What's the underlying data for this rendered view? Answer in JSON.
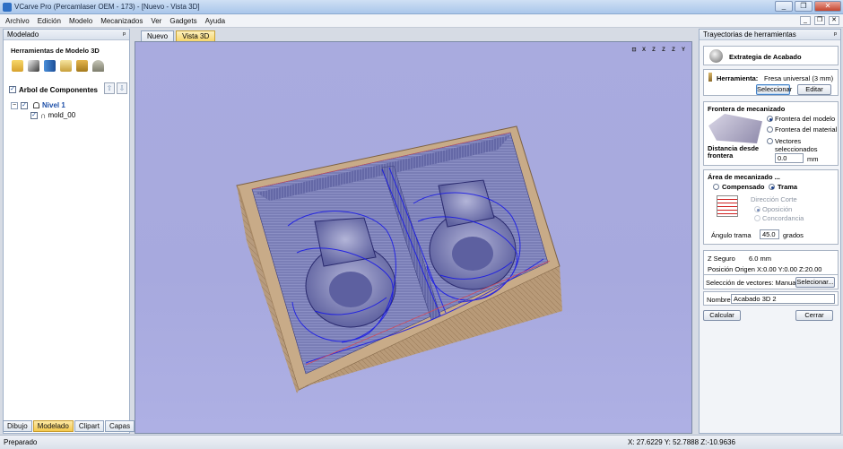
{
  "window": {
    "title": "VCarve Pro (Percamlaser OEM - 173) - [Nuevo - Vista 3D]",
    "min_label": "_",
    "restore_label": "❐",
    "close_label": "✕"
  },
  "menu": [
    "Archivo",
    "Edición",
    "Modelo",
    "Mecanizados",
    "Ver",
    "Gadgets",
    "Ayuda"
  ],
  "menu_icons": [
    "_",
    "❐",
    "✕"
  ],
  "left_panel": {
    "header": "Modelado",
    "pin": "ᵖ",
    "section_title": "Herramientas de Modelo 3D",
    "tools": [
      "open-folder-icon",
      "wrench-icon",
      "arrow-right-icon",
      "edit-pencil-icon",
      "lock-icon",
      "pile-icon"
    ],
    "component_title": "Arbol de Componentes",
    "tree": [
      {
        "label": "Nivel 1",
        "expander": "−"
      },
      {
        "label": "mold_00"
      }
    ],
    "tabs": [
      "Dibujo",
      "Modelado",
      "Clipart",
      "Capas"
    ],
    "active_tab": "Modelado"
  },
  "doc_tabs": [
    "Nuevo",
    "Vista 3D"
  ],
  "active_doc_tab": "Vista 3D",
  "view_icons": [
    "⊡",
    "X",
    "Z",
    "Z",
    "Z",
    "Y"
  ],
  "right_panel": {
    "header": "Trayectorias de herramientas",
    "pin": "ᵖ",
    "strategy": "Extrategia de Acabado",
    "tool_label": "Herramienta:",
    "tool_name": "Fresa universal (3 mm)",
    "select_btn": "Seleccionar",
    "edit_btn": "Editar",
    "boundary_title": "Frontera de mecanizado",
    "boundary_options": [
      "Frontera del modelo",
      "Frontera del material",
      "Vectores seleccionados"
    ],
    "boundary_selected": 0,
    "distance_label": "Distancia desde frontera",
    "distance_value": "0.0",
    "distance_unit": "mm",
    "area_title": "Área de mecanizado ...",
    "area_options": [
      "Compensado",
      "Trama"
    ],
    "area_selected": 1,
    "cut_direction_label": "Dirección Corte",
    "cut_direction_options": [
      "Oposición",
      "Concordancia"
    ],
    "angle_label": "Ángulo trama",
    "angle_value": "45.0",
    "angle_unit": "grados",
    "z_safe_label": "Z Seguro",
    "z_safe_value": "6.0 mm",
    "home_label": "Posición Origen X:0.00 Y:0.00 Z:20.00",
    "vector_sel_label": "Selección de vectores: Manual",
    "vector_sel_btn": "Selecionar...",
    "name_label": "Nombre:",
    "name_value": "Acabado 3D 2",
    "calc_btn": "Calcular",
    "close_btn": "Cerrar"
  },
  "status": {
    "left": "Preparado",
    "coords": "X: 27.6229 Y: 52.7888 Z:-10.9636"
  }
}
